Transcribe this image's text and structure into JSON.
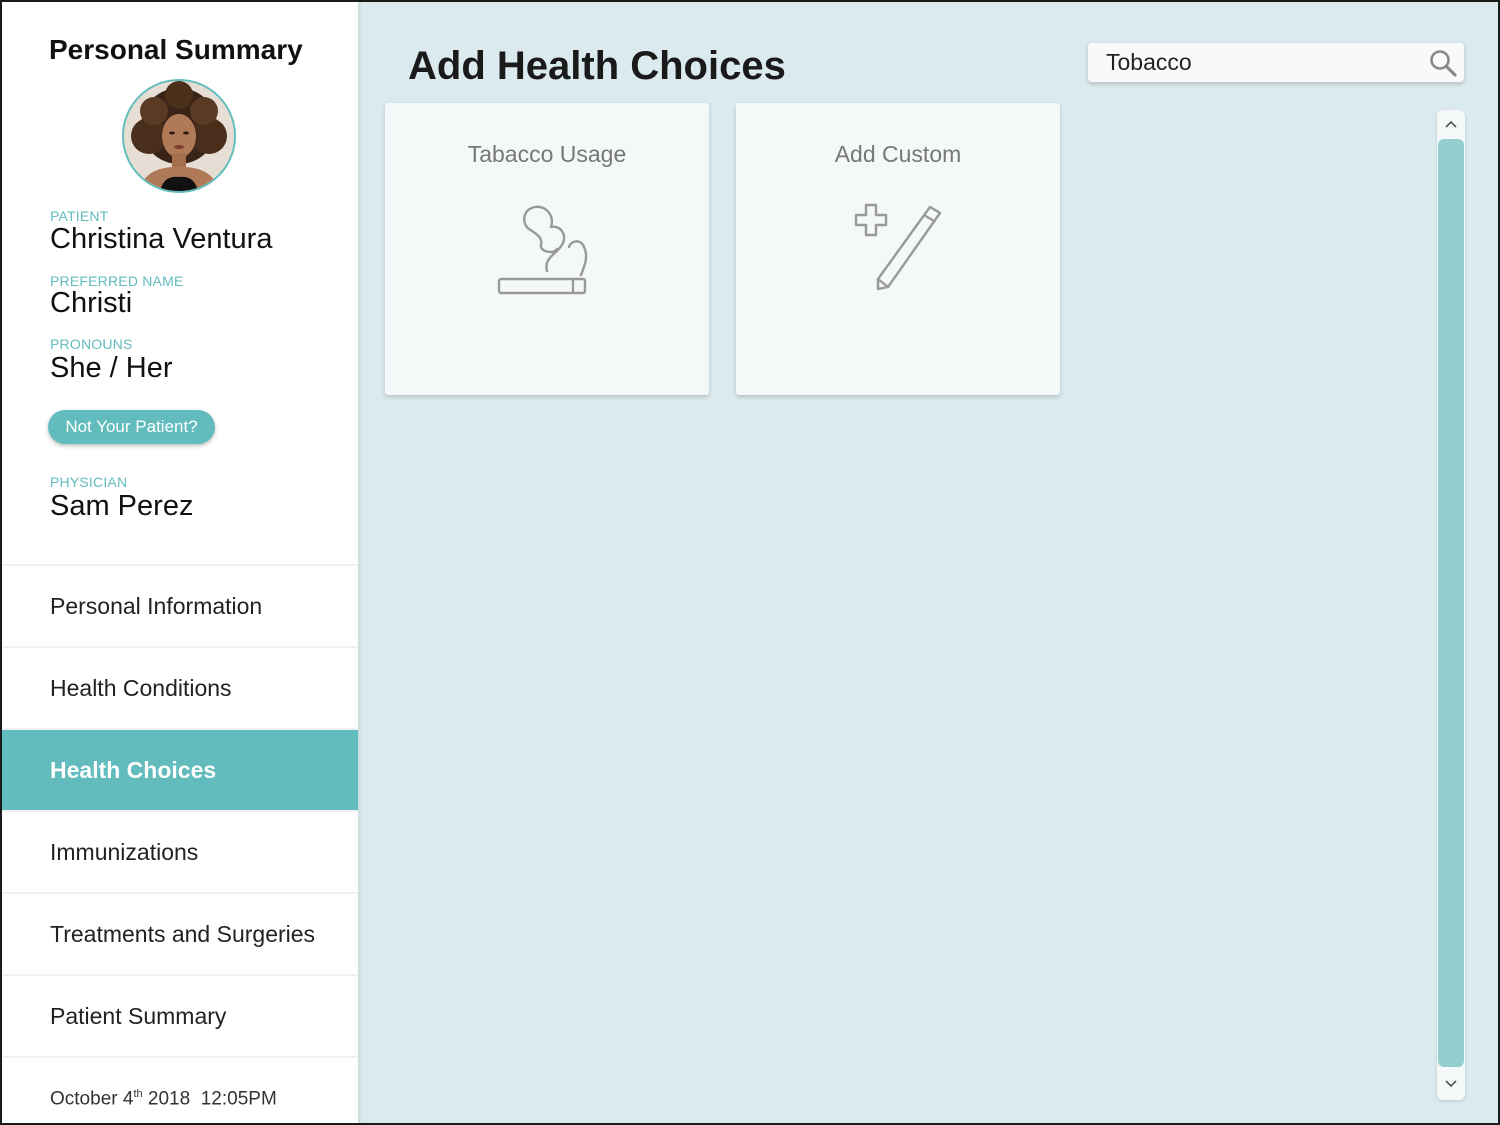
{
  "sidebar": {
    "title": "Personal Summary",
    "patient_label": "PATIENT",
    "patient_name": "Christina Ventura",
    "preferred_label": "PREFERRED NAME",
    "preferred_name": "Christi",
    "pronouns_label": "PRONOUNS",
    "pronouns": "She / Her",
    "not_patient_button": "Not Your Patient?",
    "physician_label": "PHYSICIAN",
    "physician_name": "Sam Perez",
    "nav_items": [
      {
        "label": "Personal Information",
        "active": false
      },
      {
        "label": "Health Conditions",
        "active": false
      },
      {
        "label": "Health Choices",
        "active": true
      },
      {
        "label": "Immunizations",
        "active": false
      },
      {
        "label": "Treatments and Surgeries",
        "active": false
      },
      {
        "label": "Patient Summary",
        "active": false
      }
    ],
    "timestamp": {
      "month_day": "October 4",
      "suffix": "th",
      "rest": " 2018  12:05PM"
    }
  },
  "main": {
    "title_prefix": "Add ",
    "title_bold": "Health Choices",
    "search_value": "Tobacco",
    "cards": [
      {
        "title": "Tabacco Usage",
        "icon": "smoking-cigarette-icon"
      },
      {
        "title": "Add Custom",
        "icon": "plus-pencil-icon"
      }
    ]
  },
  "colors": {
    "accent": "#62bcbd",
    "main_background": "#dbeaee",
    "card_background": "#f4f8f9",
    "scroll_thumb": "#93cfd0"
  }
}
